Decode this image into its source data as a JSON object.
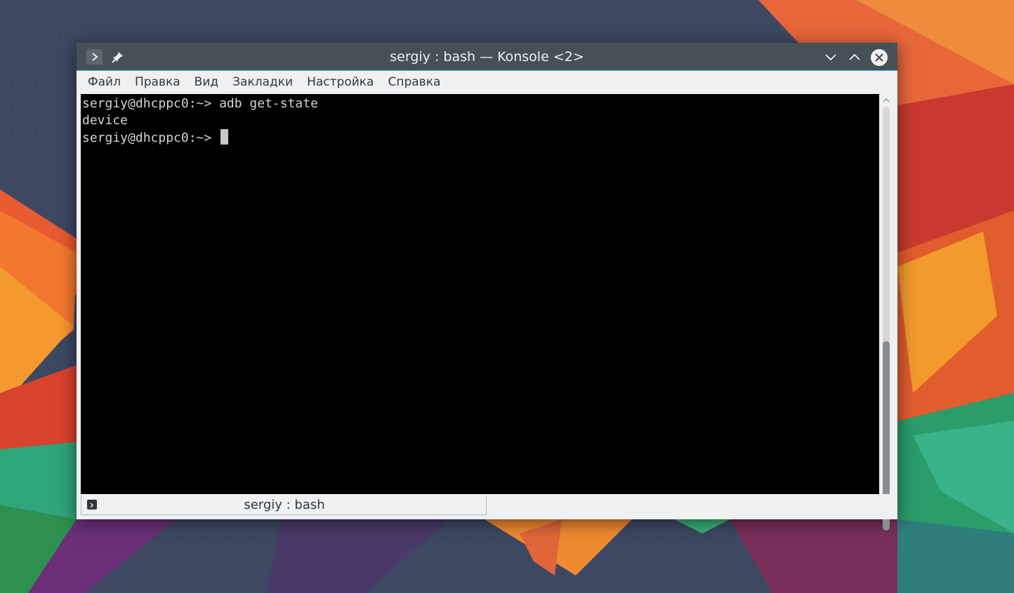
{
  "window": {
    "title": "sergiy : bash — Konsole <2>"
  },
  "menubar": {
    "items": [
      {
        "label": "Файл"
      },
      {
        "label": "Правка"
      },
      {
        "label": "Вид"
      },
      {
        "label": "Закладки"
      },
      {
        "label": "Настройка"
      },
      {
        "label": "Справка"
      }
    ]
  },
  "terminal": {
    "lines": [
      "sergiy@dhcppc0:~> adb get-state",
      "device",
      "sergiy@dhcppc0:~> "
    ]
  },
  "tabs": [
    {
      "label": "sergiy : bash",
      "active": true
    }
  ],
  "colors": {
    "titlebar": "#475057",
    "accent": "#3daee9",
    "terminal_bg": "#000000",
    "terminal_fg": "#d3d3d3",
    "chrome_bg": "#eff0f1"
  },
  "icons": {
    "app_menu": "terminal-prompt-icon",
    "pin": "pin-icon",
    "minimize": "chevron-down-icon",
    "maximize": "chevron-up-icon",
    "close": "close-icon"
  }
}
